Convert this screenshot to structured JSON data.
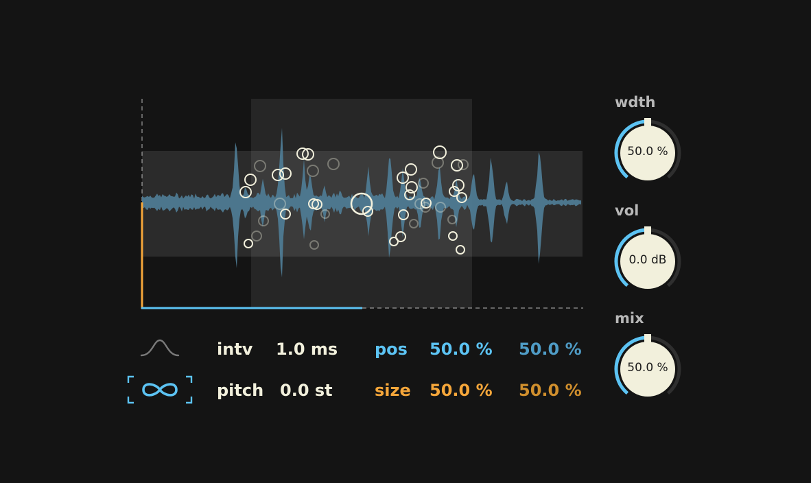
{
  "params": {
    "intv_label": "intv",
    "intv_value": "1.0 ms",
    "pitch_label": "pitch",
    "pitch_value": "0.0 st",
    "pos_label": "pos",
    "pos_value_1": "50.0 %",
    "pos_value_2": "50.0 %",
    "size_label": "size",
    "size_value_1": "50.0 %",
    "size_value_2": "50.0 %"
  },
  "knobs": {
    "wdth": {
      "label": "wdth",
      "value": "50.0 %",
      "level": 0.5
    },
    "vol": {
      "label": "vol",
      "value": "0.0 dB",
      "level": 0.5
    },
    "mix": {
      "label": "mix",
      "value": "50.0 %",
      "level": 0.5
    }
  },
  "icons": {
    "envelope": "envelope-curve-icon",
    "loop": "infinity-loop-icon"
  },
  "colors": {
    "background": "#141414",
    "accent_blue": "#5cc3f3",
    "accent_orange": "#f5a63a",
    "waveform": "#4e7a92",
    "knob_face": "#f2f0dc",
    "text_cream": "#f2f0dc",
    "label_grey": "#b8b8b8"
  }
}
